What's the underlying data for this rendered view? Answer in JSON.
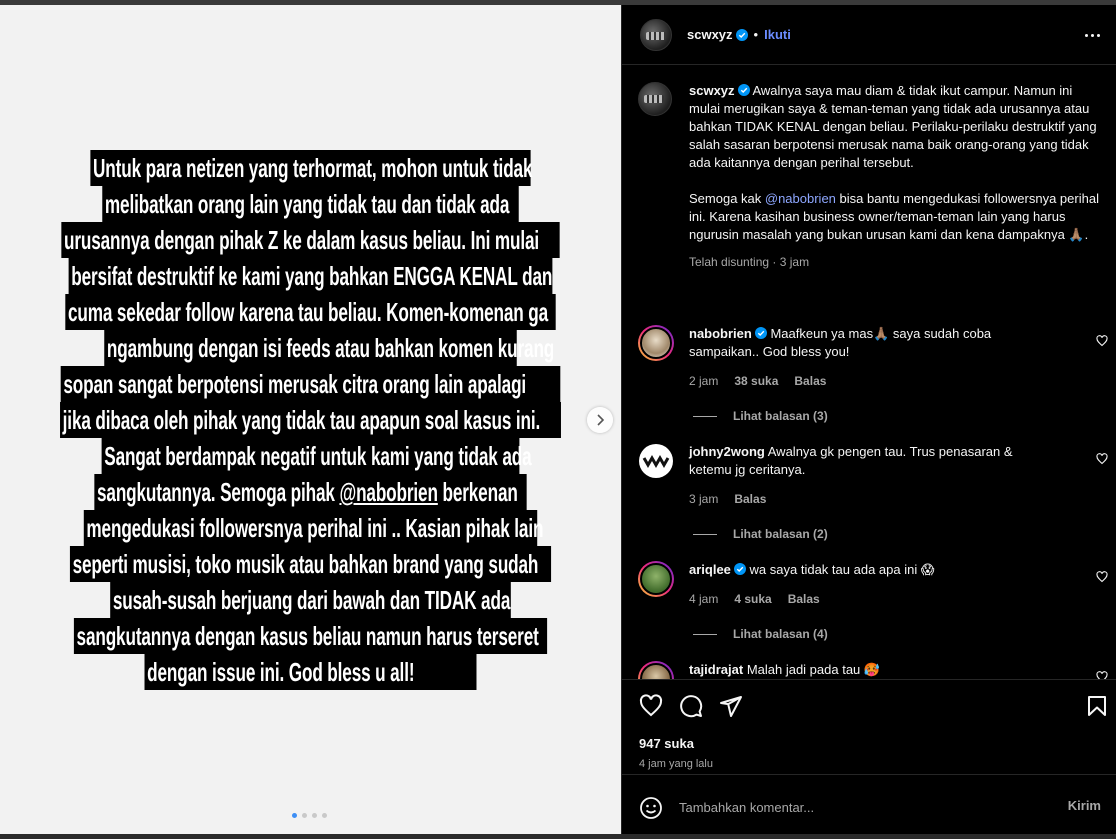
{
  "post_image": {
    "lines": [
      "Untuk para netizen yang terhormat, mohon untuk tidak",
      "melibatkan orang lain yang tidak tau dan tidak ada",
      "urusannya dengan pihak Z ke dalam kasus beliau. Ini mulai",
      "bersifat destruktif ke kami yang bahkan ENGGA KENAL dan",
      "cuma sekedar follow karena tau beliau. Komen-komenan ga",
      "ngambung dengan isi feeds atau bahkan komen kurang",
      "sopan sangat berpotensi merusak citra orang lain apalagi",
      "jika dibaca oleh pihak yang tidak tau apapun soal kasus ini.",
      "Sangat berdampak negatif untuk kami yang tidak ada",
      "sangkutannya. Semoga pihak",
      "mengedukasi followersnya perihal ini .. Kasian pihak lain",
      "seperti musisi, toko musik atau bahkan brand yang sudah",
      "susah-susah berjuang dari bawah dan TIDAK ada",
      "sangkutannya dengan kasus beliau namun harus terseret",
      "dengan issue ini. God bless u all!"
    ],
    "line10_mention": "@nabobrien",
    "line10_suffix": " berkenan"
  },
  "header": {
    "username": "scwxyz",
    "separator": "•",
    "follow_label": "Ikuti"
  },
  "caption": {
    "username": "scwxyz",
    "text_1": "Awalnya saya mau diam & tidak ikut campur. Namun ini mulai merugikan saya & teman-teman yang tidak ada urusannya atau bahkan TIDAK KENAL dengan beliau. Perilaku-perilaku destruktif yang salah sasaran berpotensi merusak nama baik orang-orang yang tidak ada kaitannya dengan perihal tersebut.",
    "text_2_prefix": "Semoga kak ",
    "text_2_mention": "@nabobrien",
    "text_2_suffix": " bisa bantu mengedukasi followersnya perihal ini. Karena kasihan business owner/teman-teman lain yang harus ngurusin masalah yang bukan urusan kami dan kena dampaknya 🙏🏽.",
    "meta": "Telah disunting · 3 jam"
  },
  "comments": [
    {
      "username": "nabobrien",
      "verified": true,
      "text": "Maafkeun ya mas🙏🏽 saya sudah coba sampaikan.. God bless you!",
      "time": "2 jam",
      "likes": "38 suka",
      "reply_label": "Balas",
      "view_replies": "Lihat balasan (3)"
    },
    {
      "username": "johny2wong",
      "verified": false,
      "text": "Awalnya gk pengen tau. Trus penasaran & ketemu jg ceritanya.",
      "time": "3 jam",
      "reply_label": "Balas",
      "view_replies": "Lihat balasan (2)"
    },
    {
      "username": "ariqlee",
      "verified": true,
      "text": "wa saya tidak tau ada apa ini 😱",
      "time": "4 jam",
      "likes": "4 suka",
      "reply_label": "Balas",
      "view_replies": "Lihat balasan (4)"
    },
    {
      "username": "tajidrajat",
      "verified": false,
      "text": "Malah jadi pada tau 🥵"
    }
  ],
  "footer": {
    "likes": "947 suka",
    "time": "4 jam yang lalu",
    "comment_placeholder": "Tambahkan komentar...",
    "post_label": "Kirim"
  },
  "colors": {
    "panel_bg": "#000000",
    "accent_link": "#6b8cff",
    "verified_badge": "#0095f6",
    "muted_text": "#a8a8a8"
  },
  "carousel": {
    "current": 1,
    "total": 4
  }
}
